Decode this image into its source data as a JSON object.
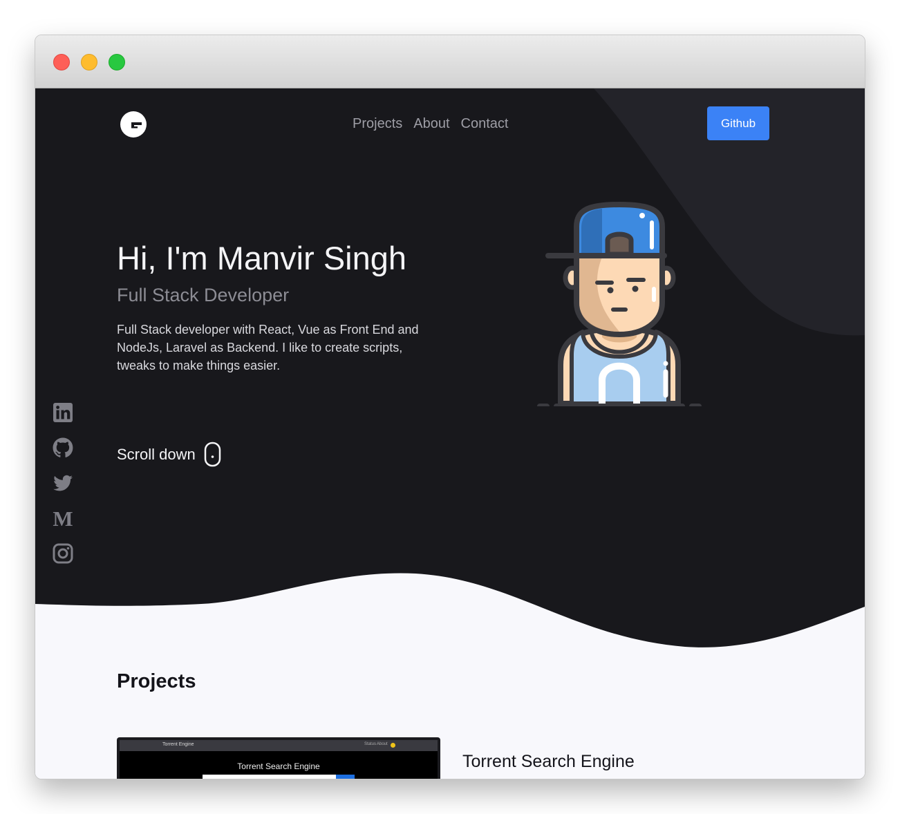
{
  "nav": {
    "logo_letter": "G",
    "links": [
      "Projects",
      "About",
      "Contact"
    ],
    "github_button": "Github"
  },
  "hero": {
    "title": "Hi, I'm Manvir Singh",
    "subtitle": "Full Stack Developer",
    "description": "Full Stack developer with React, Vue as Front End and NodeJs, Laravel as Backend. I like to create scripts, tweaks to make things easier.",
    "scroll_label": "Scroll down"
  },
  "social": [
    {
      "icon": "linkedin-icon"
    },
    {
      "icon": "github-icon"
    },
    {
      "icon": "twitter-icon"
    },
    {
      "icon": "medium-icon",
      "glyph": "M"
    },
    {
      "icon": "instagram-icon"
    }
  ],
  "projects": {
    "heading": "Projects",
    "items": [
      {
        "name": "Torrent Search Engine",
        "thumbnail": {
          "brand": "Torrent Engine",
          "links": [
            "Status",
            "About"
          ],
          "title": "Torrent Search Engine"
        }
      }
    ]
  },
  "colors": {
    "hero_bg": "#18181c",
    "hero_accent_shape": "#232329",
    "page_bg": "#f8f8fc",
    "button_blue": "#3b82f6",
    "nav_text": "#9e9ea6",
    "cap_blue": "#3d8ae0",
    "tank_top": "#a8cdef",
    "skin": "#fdd9b5"
  }
}
